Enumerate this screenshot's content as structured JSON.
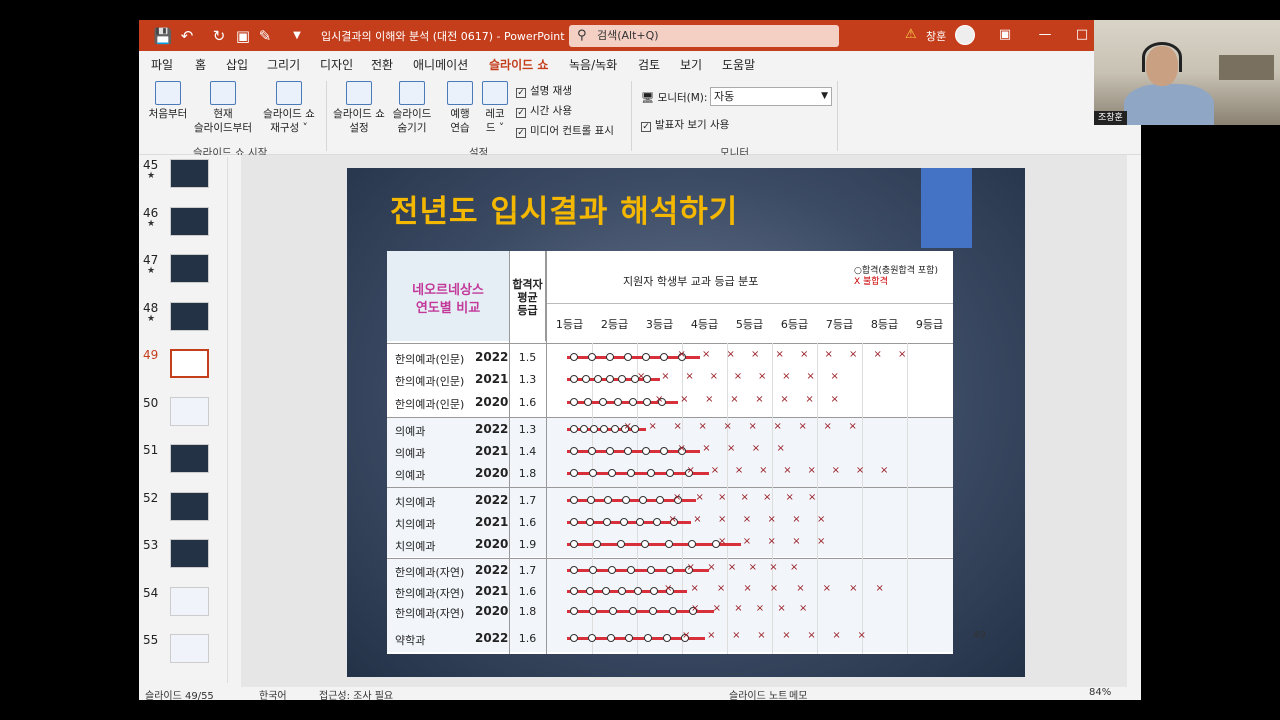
{
  "titlebar": {
    "doc_title": "입시결과의 이해와 분석 (대전 0617)  -  PowerPoint",
    "search_placeholder": "검색(Alt+Q)",
    "user_name": "창훈"
  },
  "menu": {
    "tabs": [
      "파일",
      "홈",
      "삽입",
      "그리기",
      "디자인",
      "전환",
      "애니메이션",
      "슬라이드 쇼",
      "녹음/녹화",
      "검토",
      "보기",
      "도움말"
    ],
    "active": "슬라이드 쇼"
  },
  "ribbon": {
    "from_beginning": "처음부터",
    "from_current_1": "현재",
    "from_current_2": "슬라이드부터",
    "custom_1": "슬라이드 쇼",
    "custom_2": "재구성 ˅",
    "group_start": "슬라이드 쇼 시작",
    "setup_1": "슬라이드 쇼",
    "setup_2": "설정",
    "hide_1": "슬라이드",
    "hide_2": "숨기기",
    "rehearse_1": "예행",
    "rehearse_2": "연습",
    "record_1": "레코",
    "record_2": "드 ˅",
    "chk_narration": "설명 재생",
    "chk_timing": "시간 사용",
    "chk_media": "미디어 컨트롤 표시",
    "group_setup": "설정",
    "monitor_label": "모니터(M):",
    "monitor_value": "자동",
    "presenter_view": "발표자 보기 사용",
    "group_monitor": "모니터"
  },
  "thumbnails": [
    {
      "num": "45",
      "star": "★"
    },
    {
      "num": "46",
      "star": "★"
    },
    {
      "num": "47",
      "star": "★"
    },
    {
      "num": "48",
      "star": "★"
    },
    {
      "num": "49",
      "star": ""
    },
    {
      "num": "50",
      "star": ""
    },
    {
      "num": "51",
      "star": ""
    },
    {
      "num": "52",
      "star": ""
    },
    {
      "num": "53",
      "star": ""
    },
    {
      "num": "54",
      "star": ""
    },
    {
      "num": "55",
      "star": ""
    }
  ],
  "slide": {
    "title": "전년도 입시결과 해석하기",
    "page_number": "49",
    "header_left_1": "네오르네상스",
    "header_left_2": "연도별 비교",
    "header_avg_1": "합격자",
    "header_avg_2": "평균",
    "header_avg_3": "등급",
    "header_dist": "지원자 학생부 교과 등급 분포",
    "legend_pass": "○합격(충원합격 포함)",
    "legend_fail": "X 불합격",
    "grades": [
      "1등급",
      "2등급",
      "3등급",
      "4등급",
      "5등급",
      "6등급",
      "7등급",
      "8등급",
      "9등급"
    ],
    "rows": [
      {
        "name": "한의예과(인문)",
        "year": "2022",
        "avg": "1.5",
        "pass_to": 3.9,
        "fail_to": 8.7
      },
      {
        "name": "한의예과(인문)",
        "year": "2021",
        "avg": "1.3",
        "pass_to": 3.0,
        "fail_to": 7.2
      },
      {
        "name": "한의예과(인문)",
        "year": "2020",
        "avg": "1.6",
        "pass_to": 3.4,
        "fail_to": 7.2
      },
      {
        "name": "의예과",
        "year": "2022",
        "avg": "1.3",
        "pass_to": 2.7,
        "fail_to": 7.6
      },
      {
        "name": "의예과",
        "year": "2021",
        "avg": "1.4",
        "pass_to": 3.9,
        "fail_to": 6.0
      },
      {
        "name": "의예과",
        "year": "2020",
        "avg": "1.8",
        "pass_to": 4.1,
        "fail_to": 8.3
      },
      {
        "name": "치의예과",
        "year": "2022",
        "avg": "1.7",
        "pass_to": 3.8,
        "fail_to": 6.7
      },
      {
        "name": "치의예과",
        "year": "2021",
        "avg": "1.6",
        "pass_to": 3.7,
        "fail_to": 6.9
      },
      {
        "name": "치의예과",
        "year": "2020",
        "avg": "1.9",
        "pass_to": 4.8,
        "fail_to": 6.9
      },
      {
        "name": "한의예과(자연)",
        "year": "2022",
        "avg": "1.7",
        "pass_to": 4.1,
        "fail_to": 6.3
      },
      {
        "name": "한의예과(자연)",
        "year": "2021",
        "avg": "1.6",
        "pass_to": 3.6,
        "fail_to": 8.2
      },
      {
        "name": "한의예과(자연)",
        "year": "2020",
        "avg": "1.8",
        "pass_to": 4.2,
        "fail_to": 6.5
      },
      {
        "name": "약학과",
        "year": "2022",
        "avg": "1.6",
        "pass_to": 4.0,
        "fail_to": 7.8
      }
    ]
  },
  "statusbar": {
    "slide_info": "슬라이드 49/55",
    "lang": "한국어",
    "accessibility": "접근성: 조사 필요",
    "notes": "슬라이드 노트",
    "comments": "메모",
    "zoom": "84%"
  },
  "webcam": {
    "label": "조창훈"
  }
}
